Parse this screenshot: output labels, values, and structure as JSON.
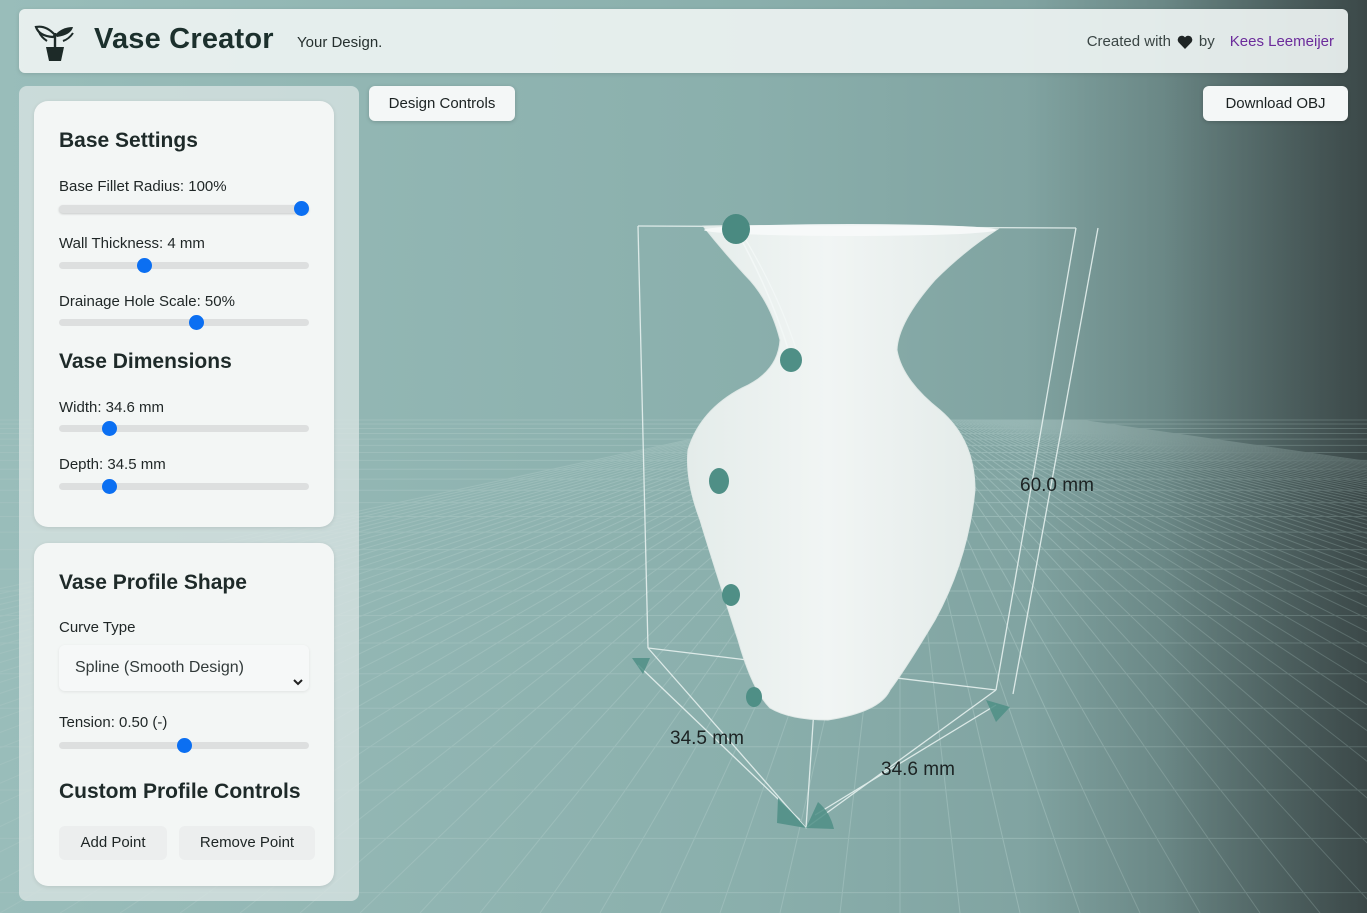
{
  "header": {
    "title": "Vase Creator",
    "subtitle": "Your Design.",
    "credit_prefix": "Created with",
    "credit_by": "by",
    "author": "Kees Leemeijer",
    "logo_icon": "plant-pot-icon",
    "heart_icon": "heart-icon"
  },
  "toolbar": {
    "design_controls_label": "Design Controls",
    "download_label": "Download OBJ"
  },
  "base_settings": {
    "heading": "Base Settings",
    "fillet": {
      "label": "Base Fillet Radius: 100%",
      "value": 1.0
    },
    "wall": {
      "label": "Wall Thickness: 4 mm",
      "value": 0.34
    },
    "drainage": {
      "label": "Drainage Hole Scale: 50%",
      "value": 0.55
    }
  },
  "dimensions": {
    "heading": "Vase Dimensions",
    "width": {
      "label": "Width: 34.6 mm",
      "value": 0.2
    },
    "depth": {
      "label": "Depth: 34.5 mm",
      "value": 0.2
    }
  },
  "profile": {
    "heading": "Vase Profile Shape",
    "curve_label": "Curve Type",
    "curve_value": "Spline (Smooth Design)",
    "tension": {
      "label": "Tension: 0.50 (-)",
      "value": 0.5
    }
  },
  "custom": {
    "heading": "Custom Profile Controls",
    "add_label": "Add Point",
    "remove_label": "Remove Point"
  },
  "viewport": {
    "height_label": "60.0 mm",
    "depth_label": "34.5 mm",
    "width_label": "34.6 mm"
  },
  "colors": {
    "accent": "#0b6ff2",
    "author_link": "#6b2b9b",
    "vase": "#eef3f2",
    "control_point": "#4f8f86"
  }
}
